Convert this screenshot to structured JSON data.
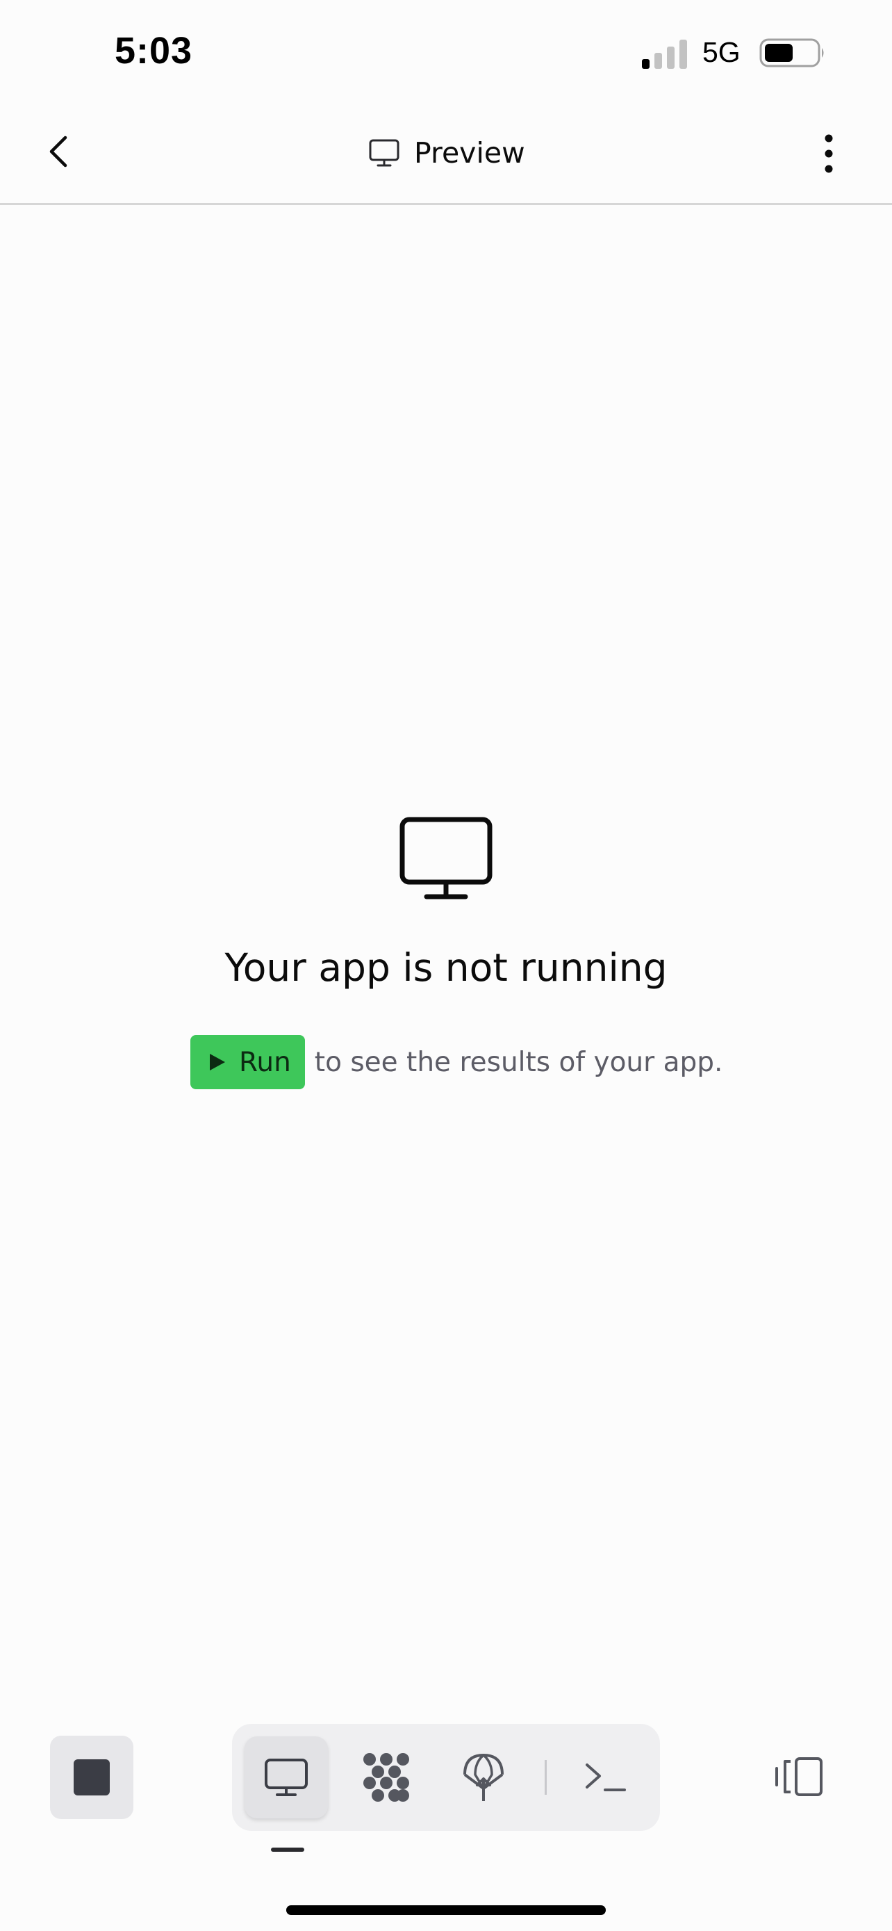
{
  "status_bar": {
    "time": "5:03",
    "network": "5G",
    "signal_bars_active": 1,
    "signal_bars_total": 4,
    "battery_level": 0.55
  },
  "header": {
    "title": "Preview",
    "title_icon": "monitor-icon",
    "back_icon": "chevron-left-icon",
    "menu_icon": "more-vertical-icon"
  },
  "empty_state": {
    "icon": "monitor-icon",
    "title": "Your app is not running",
    "run_label": "Run",
    "run_icon": "play-icon",
    "hint": "to see the results of your app.",
    "run_color": "#3ec75a"
  },
  "toolbar": {
    "stop_icon": "stop-icon",
    "tools": [
      {
        "name": "preview",
        "icon": "monitor-icon",
        "active": true
      },
      {
        "name": "packages",
        "icon": "dots-cluster-icon",
        "active": false
      },
      {
        "name": "deploy",
        "icon": "parachute-upload-icon",
        "active": false
      },
      {
        "name": "shell",
        "icon": "terminal-icon",
        "active": false
      }
    ],
    "layout_icon": "layout-panels-icon"
  },
  "colors": {
    "background": "#fcfcfc",
    "text": "#0b0b0b",
    "muted_text": "#5c5c66",
    "accent_green": "#3ec75a"
  }
}
